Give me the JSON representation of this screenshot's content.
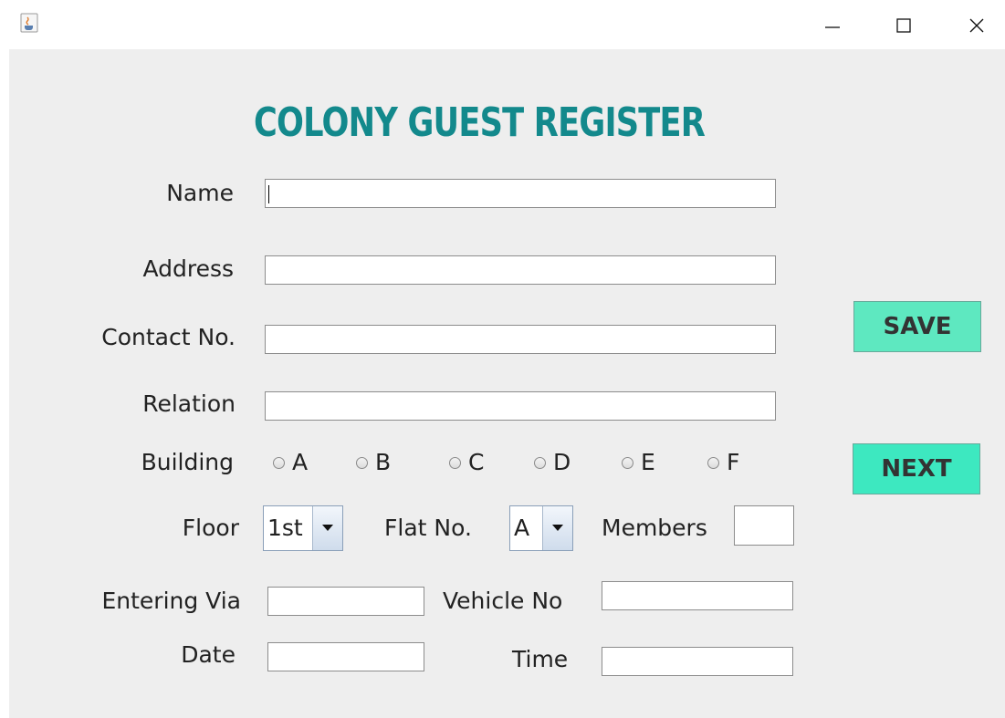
{
  "window": {
    "icon": "java-cup-icon",
    "controls": {
      "minimize": "minimize-icon",
      "maximize": "maximize-icon",
      "close": "close-icon"
    }
  },
  "form": {
    "heading": "COLONY GUEST REGISTER",
    "labels": {
      "name": "Name",
      "address": "Address",
      "contact": "Contact No.",
      "relation": "Relation",
      "building": "Building",
      "floor": "Floor",
      "flat": "Flat No.",
      "members": "Members",
      "entering_via": "Entering Via",
      "vehicle": "Vehicle No",
      "date": "Date",
      "time": "Time"
    },
    "values": {
      "name": "",
      "address": "",
      "contact": "",
      "relation": "",
      "members": "",
      "entering_via": "",
      "vehicle": "",
      "date": "",
      "time": ""
    },
    "building_options": [
      "A",
      "B",
      "C",
      "D",
      "E",
      "F"
    ],
    "floor_selected": "1st",
    "flat_selected": "A"
  },
  "buttons": {
    "save": "SAVE",
    "next": "NEXT"
  },
  "colors": {
    "heading": "#13898c",
    "save_button": "#5ee8c0",
    "next_button": "#3de8c0",
    "panel": "#eeeeee"
  }
}
